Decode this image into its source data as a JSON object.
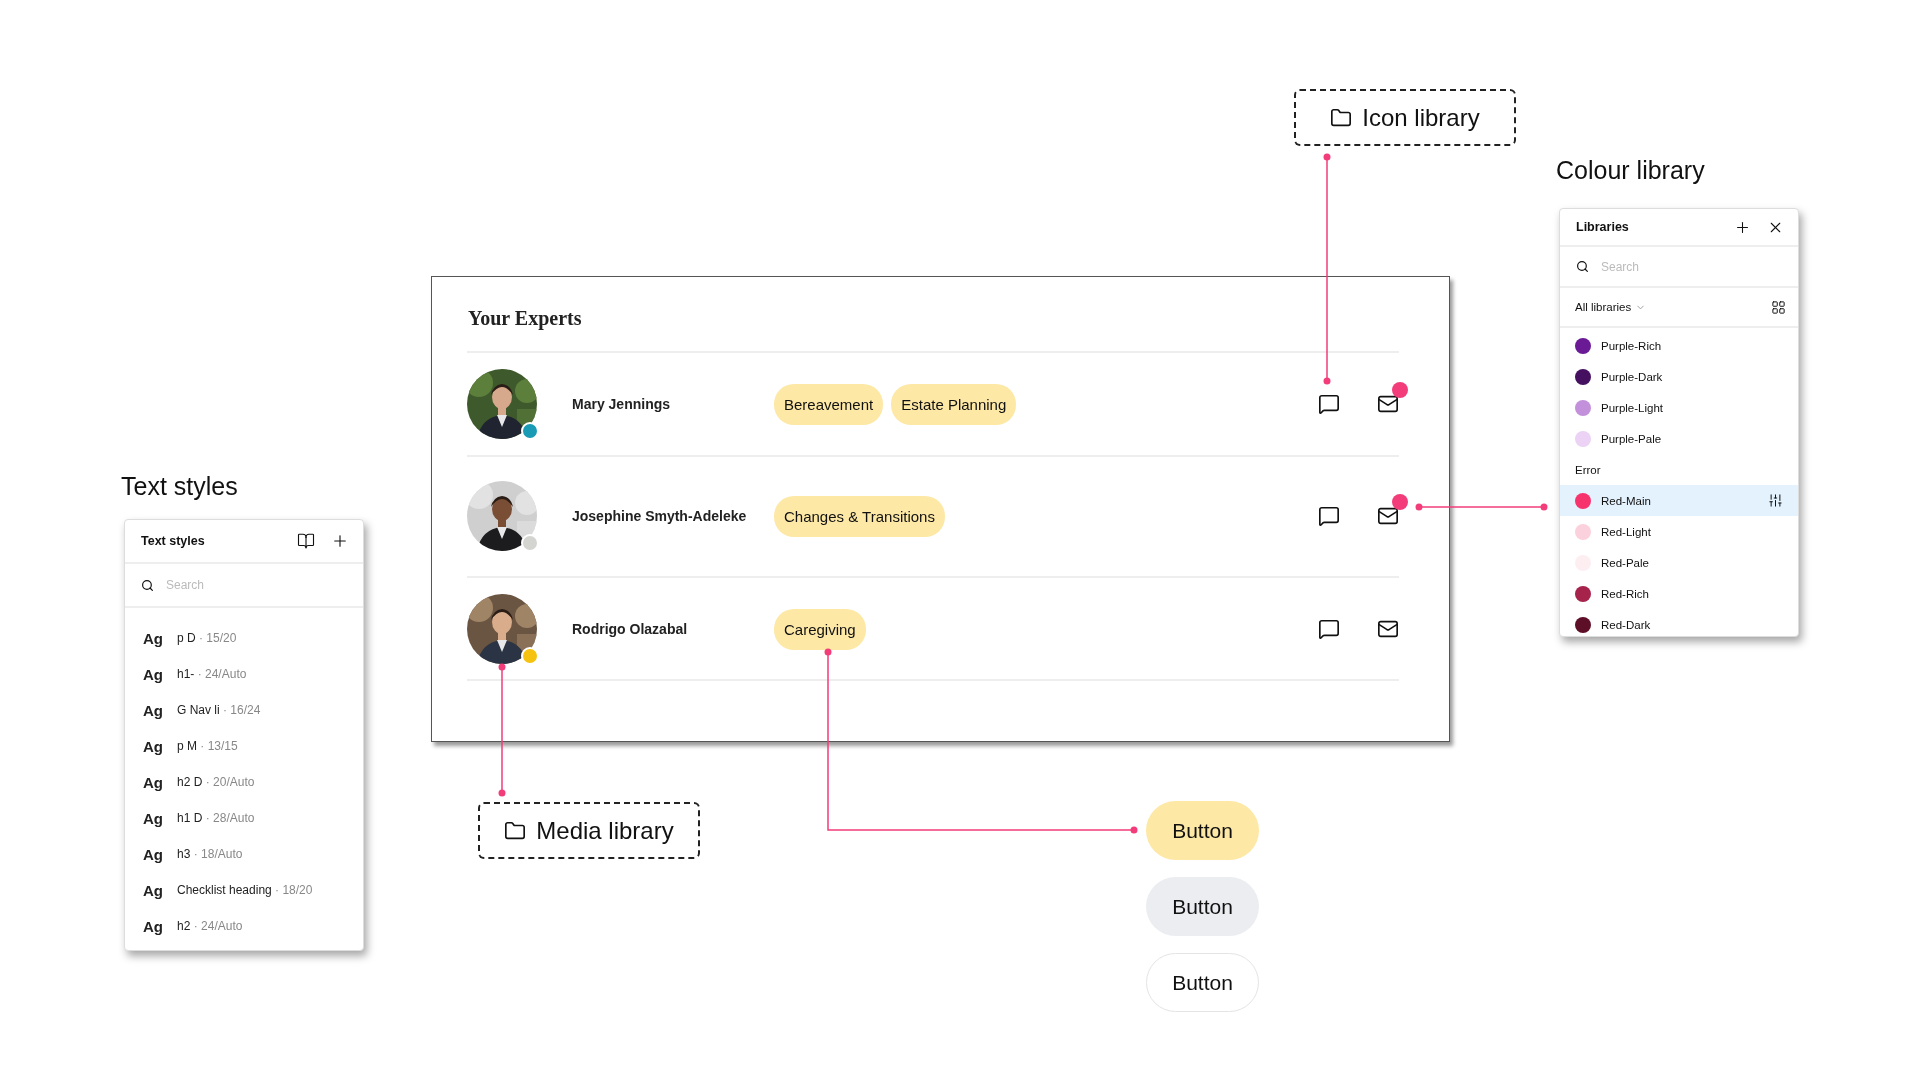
{
  "text_styles": {
    "caption": "Text styles",
    "title": "Text styles",
    "search": {
      "placeholder": "Search"
    },
    "styles": [
      {
        "sample": "Ag",
        "name": "p D",
        "spec": "· 15/20"
      },
      {
        "sample": "Ag",
        "name": "h1-",
        "spec": "· 24/Auto"
      },
      {
        "sample": "Ag",
        "name": "G Nav li",
        "spec": "· 16/24"
      },
      {
        "sample": "Ag",
        "name": "p M",
        "spec": "· 13/15"
      },
      {
        "sample": "Ag",
        "name": "h2 D",
        "spec": "· 20/Auto"
      },
      {
        "sample": "Ag",
        "name": "h1 D",
        "spec": "· 28/Auto"
      },
      {
        "sample": "Ag",
        "name": "h3",
        "spec": "· 18/Auto"
      },
      {
        "sample": "Ag",
        "name": "Checklist heading",
        "spec": "· 18/20"
      },
      {
        "sample": "Ag",
        "name": "h2",
        "spec": "· 24/Auto"
      }
    ]
  },
  "experts": {
    "title": "Your Experts",
    "rows": [
      {
        "name": "Mary Jennings",
        "color": "#1a9bb5",
        "tags": [
          "Bereavement",
          "Estate Planning"
        ],
        "mail_badge": true
      },
      {
        "name": "Josephine Smyth-Adeleke",
        "color": "#d4d4d0",
        "tags": [
          "Changes & Transitions"
        ],
        "mail_badge": true
      },
      {
        "name": "Rodrigo Olazabal",
        "color": "#f5c20f",
        "tags": [
          "Caregiving"
        ],
        "mail_badge": false
      }
    ]
  },
  "icon_library": {
    "label": "Icon library"
  },
  "media_library": {
    "label": "Media library"
  },
  "colour_library": {
    "caption": "Colour library",
    "title": "Libraries",
    "search": {
      "placeholder": "Search"
    },
    "filter": "All libraries",
    "items": [
      {
        "kind": "swatch",
        "name": "Purple-Rich",
        "color": "#6b1a96",
        "selected": false
      },
      {
        "kind": "swatch",
        "name": "Purple-Dark",
        "color": "#45105f",
        "selected": false
      },
      {
        "kind": "swatch",
        "name": "Purple-Light",
        "color": "#c390dc",
        "selected": false
      },
      {
        "kind": "swatch",
        "name": "Purple-Pale",
        "color": "#ecd2f4",
        "selected": false
      },
      {
        "kind": "heading",
        "name": "Error"
      },
      {
        "kind": "swatch",
        "name": "Red-Main",
        "color": "#f7336e",
        "selected": true
      },
      {
        "kind": "swatch",
        "name": "Red-Light",
        "color": "#fbd1dd",
        "selected": false
      },
      {
        "kind": "swatch",
        "name": "Red-Pale",
        "color": "#fdeef2",
        "selected": false
      },
      {
        "kind": "swatch",
        "name": "Red-Rich",
        "color": "#a6234b",
        "selected": false
      },
      {
        "kind": "swatch",
        "name": "Red-Dark",
        "color": "#5e0f28",
        "selected": false
      }
    ]
  },
  "buttons": [
    {
      "label": "Button",
      "kind": "primary"
    },
    {
      "label": "Button",
      "kind": "secondary"
    },
    {
      "label": "Button",
      "kind": "outline"
    }
  ]
}
